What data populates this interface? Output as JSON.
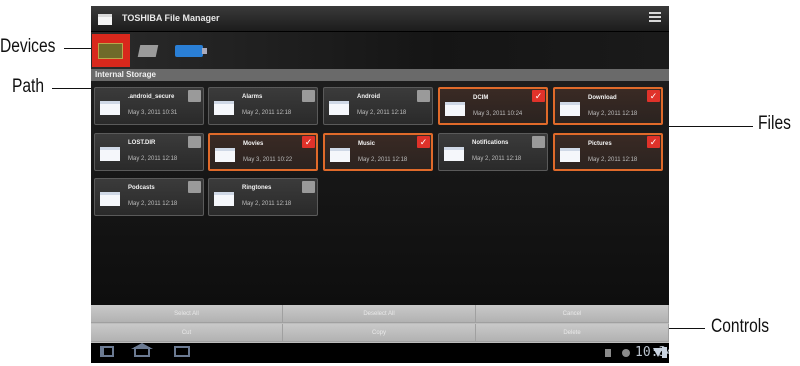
{
  "callouts": {
    "devices": "Devices",
    "path": "Path",
    "files": "Files",
    "controls": "Controls"
  },
  "app": {
    "title": "TOSHIBA File Manager"
  },
  "device_bar": {
    "items": [
      "internal-storage-icon",
      "sd-card-icon",
      "usb-drive-icon"
    ],
    "selected": 0
  },
  "path": "Internal Storage",
  "files": [
    {
      "name": ".android_secure",
      "date": "May 3, 2011 10:31",
      "selected": false
    },
    {
      "name": "Alarms",
      "date": "May 2, 2011 12:18",
      "selected": false
    },
    {
      "name": "Android",
      "date": "May 2, 2011 12:18",
      "selected": false
    },
    {
      "name": "DCIM",
      "date": "May 3, 2011 10:24",
      "selected": true
    },
    {
      "name": "Download",
      "date": "May 2, 2011 12:18",
      "selected": true
    },
    {
      "name": "LOST.DIR",
      "date": "May 2, 2011 12:18",
      "selected": false
    },
    {
      "name": "Movies",
      "date": "May 3, 2011 10:22",
      "selected": true
    },
    {
      "name": "Music",
      "date": "May 2, 2011 12:18",
      "selected": true
    },
    {
      "name": "Notifications",
      "date": "May 2, 2011 12:18",
      "selected": false
    },
    {
      "name": "Pictures",
      "date": "May 2, 2011 12:18",
      "selected": true
    },
    {
      "name": "Podcasts",
      "date": "May 2, 2011 12:18",
      "selected": false
    },
    {
      "name": "Ringtones",
      "date": "May 2, 2011 12:18",
      "selected": false
    }
  ],
  "controls": {
    "select_all": "Select All",
    "deselect_all": "Deselect All",
    "cancel": "Cancel",
    "cut": "Cut",
    "copy": "Copy",
    "delete": "Delete"
  },
  "status": {
    "time": "10:34"
  },
  "colors": {
    "selected_border": "#e06a2a",
    "selected_check": "#e0322a",
    "device_selected": "#d8281c"
  }
}
